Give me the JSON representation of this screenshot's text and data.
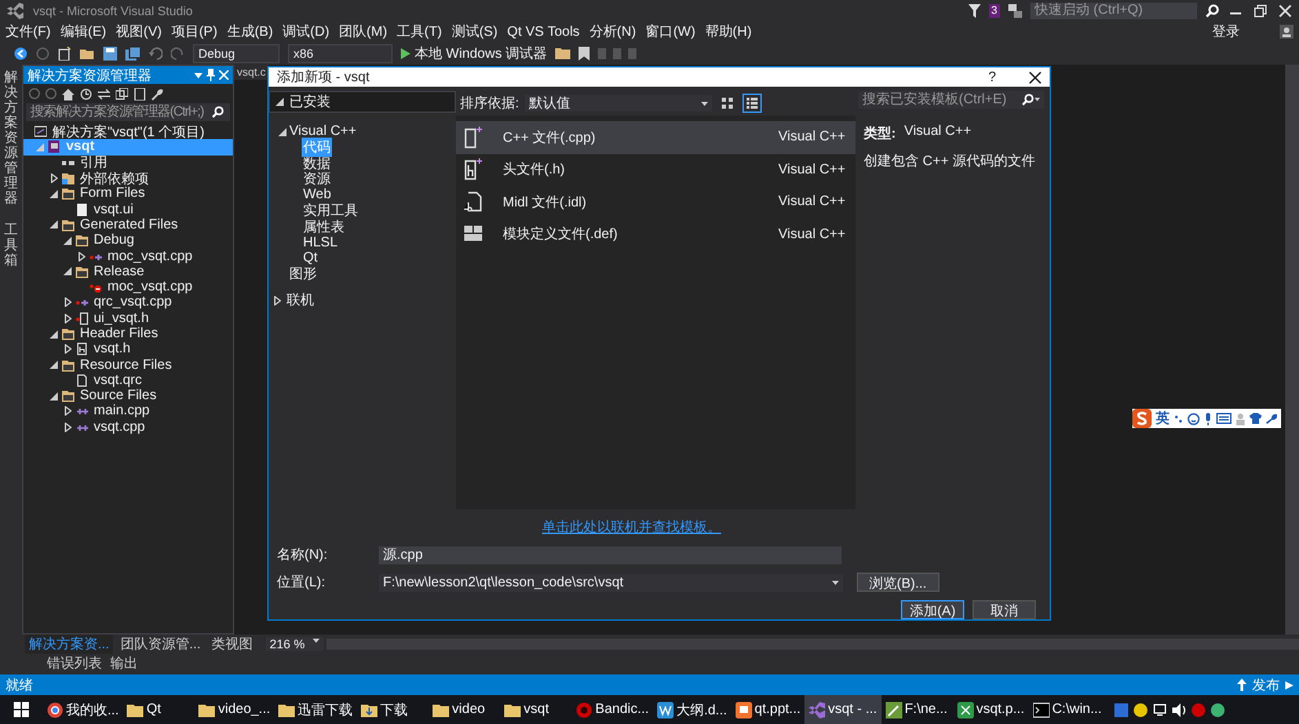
{
  "window": {
    "title": "vsqt - Microsoft Visual Studio",
    "notification_count": "3",
    "quick_launch": {
      "placeholder": "快速启动 (Ctrl+Q)"
    },
    "sign_in": "登录"
  },
  "menu": [
    "文件(F)",
    "编辑(E)",
    "视图(V)",
    "项目(P)",
    "生成(B)",
    "调试(D)",
    "团队(M)",
    "工具(T)",
    "测试(S)",
    "Qt VS Tools",
    "分析(N)",
    "窗口(W)",
    "帮助(H)"
  ],
  "toolbar": {
    "configuration": "Debug",
    "platform": "x86",
    "debugger": "本地 Windows 调试器"
  },
  "side_strip": [
    "解决方案资源管理器",
    "工具箱"
  ],
  "solution_explorer": {
    "title": "解决方案资源管理器",
    "search": {
      "placeholder": "搜索解决方案资源管理器(Ctrl+;)"
    },
    "tree": [
      {
        "label": "解决方案\"vsqt\"(1 个项目)",
        "kind": "solution",
        "selected": false
      },
      {
        "label": "vsqt",
        "kind": "project",
        "expanded": true,
        "selected": true,
        "children": [
          {
            "label": "引用",
            "kind": "references",
            "selected": false
          },
          {
            "label": "外部依赖项",
            "kind": "dependencies",
            "expanded": false,
            "selected": false
          },
          {
            "label": "Form Files",
            "kind": "folder",
            "expanded": true,
            "selected": false,
            "children": [
              {
                "label": "vsqt.ui",
                "kind": "ui",
                "selected": false
              }
            ]
          },
          {
            "label": "Generated Files",
            "kind": "folder",
            "expanded": true,
            "selected": false,
            "children": [
              {
                "label": "Debug",
                "kind": "folder",
                "expanded": true,
                "selected": false,
                "children": [
                  {
                    "label": "moc_vsqt.cpp",
                    "kind": "generated",
                    "expanded": false,
                    "selected": false
                  }
                ]
              },
              {
                "label": "Release",
                "kind": "folder",
                "expanded": true,
                "selected": false,
                "children": [
                  {
                    "label": "moc_vsqt.cpp",
                    "kind": "excluded",
                    "selected": false
                  }
                ]
              },
              {
                "label": "qrc_vsqt.cpp",
                "kind": "generated",
                "expanded": false,
                "selected": false
              },
              {
                "label": "ui_vsqt.h",
                "kind": "generated-header",
                "expanded": false,
                "selected": false
              }
            ]
          },
          {
            "label": "Header Files",
            "kind": "folder",
            "expanded": true,
            "selected": false,
            "children": [
              {
                "label": "vsqt.h",
                "kind": "header",
                "expanded": false,
                "selected": false
              }
            ]
          },
          {
            "label": "Resource Files",
            "kind": "folder",
            "expanded": true,
            "selected": false,
            "children": [
              {
                "label": "vsqt.qrc",
                "kind": "file",
                "selected": false
              }
            ]
          },
          {
            "label": "Source Files",
            "kind": "folder",
            "expanded": true,
            "selected": false,
            "children": [
              {
                "label": "main.cpp",
                "kind": "cpp",
                "expanded": false,
                "selected": false
              },
              {
                "label": "vsqt.cpp",
                "kind": "cpp",
                "expanded": false,
                "selected": false
              }
            ]
          }
        ]
      }
    ]
  },
  "editor_tab": "vsqt.c",
  "panel_tabs": [
    {
      "label": "解决方案资...",
      "selected": true
    },
    {
      "label": "团队资源管...",
      "selected": false
    },
    {
      "label": "类视图",
      "selected": false
    }
  ],
  "zoom": "216 %",
  "output_tabs": [
    "错误列表",
    "输出"
  ],
  "status_bar": {
    "text": "就绪",
    "publish": "发布"
  },
  "dialog": {
    "title": "添加新项 - vsqt",
    "help": "?",
    "sections": [
      {
        "label": "已安装",
        "kind": "header",
        "expanded": true,
        "children": [
          {
            "label": "Visual C++",
            "expanded": true,
            "selected": false,
            "children": [
              {
                "label": "代码",
                "selected": true
              },
              {
                "label": "数据",
                "selected": false
              },
              {
                "label": "资源",
                "selected": false
              },
              {
                "label": "Web",
                "selected": false
              },
              {
                "label": "实用工具",
                "selected": false
              },
              {
                "label": "属性表",
                "selected": false
              },
              {
                "label": "HLSL",
                "selected": false
              },
              {
                "label": "Qt",
                "selected": false
              }
            ]
          },
          {
            "label": "图形",
            "selected": false
          }
        ]
      },
      {
        "label": "联机",
        "kind": "group",
        "expanded": false
      }
    ],
    "sort": {
      "label": "排序依据:",
      "value": "默认值"
    },
    "view_modes": [
      {
        "kind": "grid",
        "selected": false
      },
      {
        "kind": "list",
        "selected": true
      }
    ],
    "search": {
      "placeholder": "搜索已安装模板(Ctrl+E)"
    },
    "templates": [
      {
        "name": "C++ 文件(.cpp)",
        "type": "Visual C++",
        "kind": "cpp",
        "selected": true
      },
      {
        "name": "头文件(.h)",
        "type": "Visual C++",
        "kind": "h",
        "selected": false
      },
      {
        "name": "Midl 文件(.idl)",
        "type": "Visual C++",
        "kind": "idl",
        "selected": false
      },
      {
        "name": "模块定义文件(.def)",
        "type": "Visual C++",
        "kind": "def",
        "selected": false
      }
    ],
    "details": {
      "type_label": "类型:",
      "type_value": "Visual C++",
      "description": "创建包含 C++ 源代码的文件"
    },
    "online_link": "单击此处以联机并查找模板。",
    "name_field": {
      "label": "名称(N):",
      "value": "源.cpp"
    },
    "location_field": {
      "label": "位置(L):",
      "value": "F:\\new\\lesson2\\qt\\lesson_code\\src\\vsqt"
    },
    "browse": "浏览(B)...",
    "buttons": [
      {
        "label": "添加(A)",
        "kind": "primary"
      },
      {
        "label": "取消",
        "kind": "normal"
      }
    ]
  },
  "ime_bar": {
    "mode": "英"
  },
  "taskbar": [
    {
      "label": "我的收...",
      "kind": "browser",
      "selected": false
    },
    {
      "label": "Qt",
      "kind": "folder",
      "selected": false
    },
    {
      "label": "video_...",
      "kind": "folder",
      "selected": false
    },
    {
      "label": "迅雷下载",
      "kind": "folder",
      "selected": false
    },
    {
      "label": "下载",
      "kind": "download",
      "selected": false
    },
    {
      "label": "video",
      "kind": "folder",
      "selected": false
    },
    {
      "label": "vsqt",
      "kind": "folder",
      "selected": false
    },
    {
      "label": "Bandic...",
      "kind": "record",
      "selected": false
    },
    {
      "label": "大纲.d...",
      "kind": "doc",
      "selected": false
    },
    {
      "label": "qt.ppt...",
      "kind": "slides",
      "selected": false
    },
    {
      "label": "vsqt - ...",
      "kind": "vs",
      "selected": true
    },
    {
      "label": "F:\\ne...",
      "kind": "editor",
      "selected": false
    },
    {
      "label": "vsqt.p...",
      "kind": "sheet",
      "selected": false
    },
    {
      "label": "C:\\win...",
      "kind": "console",
      "selected": false
    }
  ]
}
